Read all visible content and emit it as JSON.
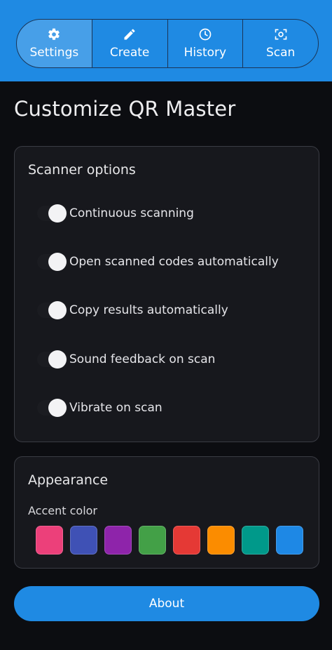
{
  "nav": {
    "tabs": [
      {
        "label": "Settings",
        "icon": "gear-icon",
        "active": true
      },
      {
        "label": "Create",
        "icon": "pencil-icon",
        "active": false
      },
      {
        "label": "History",
        "icon": "clock-icon",
        "active": false
      },
      {
        "label": "Scan",
        "icon": "scan-icon",
        "active": false
      }
    ]
  },
  "page": {
    "title": "Customize QR Master"
  },
  "scanner": {
    "title": "Scanner options",
    "options": [
      {
        "label": "Continuous scanning"
      },
      {
        "label": "Open scanned codes automatically"
      },
      {
        "label": "Copy results automatically"
      },
      {
        "label": "Sound feedback on scan"
      },
      {
        "label": "Vibrate on scan"
      }
    ]
  },
  "appearance": {
    "title": "Appearance",
    "accent_label": "Accent color",
    "accent_colors": [
      "#ec407a",
      "#3f51b5",
      "#8e24aa",
      "#43a047",
      "#e53935",
      "#fb8c00",
      "#00998a",
      "#1e88e5"
    ]
  },
  "about": {
    "label": "About"
  },
  "colors": {
    "primary": "#1f8ae3",
    "background": "#0c0d11",
    "card": "#17181d"
  }
}
